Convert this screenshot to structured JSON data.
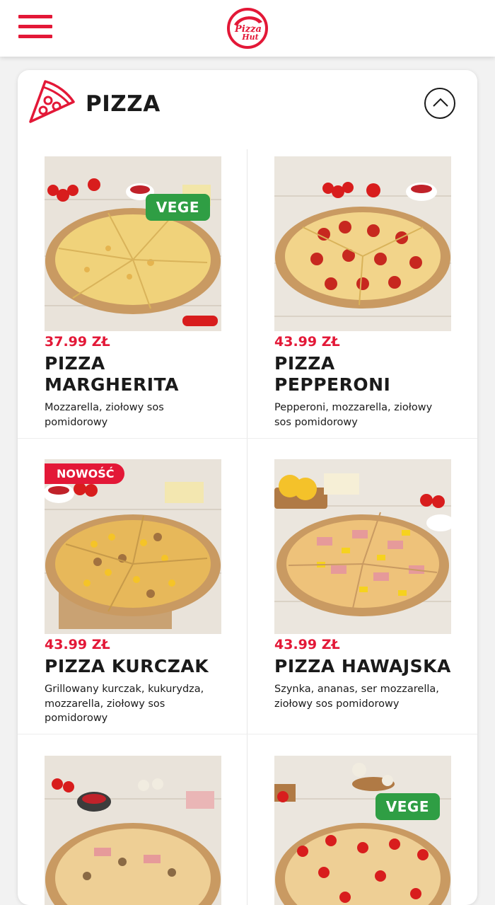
{
  "header": {
    "menu_icon": "hamburger-menu-icon",
    "logo_text_1": "Pizza",
    "logo_text_2": "Hut",
    "brand_color": "#e31837"
  },
  "section": {
    "title": "PIZZA",
    "icon": "pizza-slice-icon",
    "collapse_icon": "chevron-up-icon"
  },
  "products": [
    {
      "price": "37.99 ZŁ",
      "name": "PIZZA MARGHERITA",
      "description": "Mozzarella, ziołowy sos pomidorowy",
      "badge": "VEGE"
    },
    {
      "price": "43.99 ZŁ",
      "name": "PIZZA PEPPERONI",
      "description": "Pepperoni, mozzarella,  ziołowy sos pomidorowy",
      "badge": ""
    },
    {
      "price": "43.99 ZŁ",
      "name": "PIZZA KURCZAK",
      "description": "Grillowany kurczak, kukurydza, mozzarella, ziołowy sos pomidorowy",
      "badge": "NOWOŚĆ"
    },
    {
      "price": "43.99 ZŁ",
      "name": "PIZZA HAWAJSKA",
      "description": "Szynka, ananas, ser mozzarella, ziołowy sos pomidorowy",
      "badge": ""
    },
    {
      "price": "",
      "name": "",
      "description": "",
      "badge": ""
    },
    {
      "price": "",
      "name": "",
      "description": "",
      "badge": "VEGE"
    }
  ],
  "colors": {
    "accent": "#e31837",
    "vege_badge": "#2f9e44",
    "text": "#1a1a1a"
  }
}
